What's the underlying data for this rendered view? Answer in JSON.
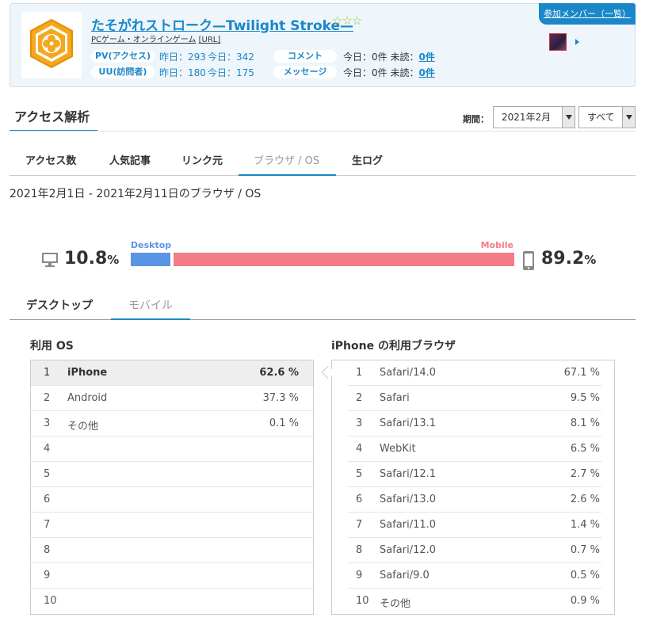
{
  "header": {
    "title": "たそがれストローク—Twilight Stroke—",
    "stars": "☆☆☆",
    "category": "PCゲーム・オンラインゲーム",
    "url_link": "[URL]",
    "member_button": "参加メンバー（一覧）",
    "pv_label": "PV(アクセス)",
    "uu_label": "UU(訪問者)",
    "pv_yesterday": "昨日：293",
    "pv_today": "今日：342",
    "uu_yesterday": "昨日：180",
    "uu_today": "今日：175",
    "comment_label": "コメント",
    "message_label": "メッセージ",
    "comment_today": "今日：0件",
    "comment_unread_label": "未読：",
    "comment_unread": "0件",
    "message_today": "今日：0件",
    "message_unread_label": "未読：",
    "message_unread": "0件"
  },
  "section": {
    "title": "アクセス解析",
    "period_label": "期間：",
    "period_value": "2021年2月",
    "filter_value": "すべて"
  },
  "tabs": [
    "アクセス数",
    "人気記事",
    "リンク元",
    "ブラウザ / OS",
    "生ログ"
  ],
  "date_range": "2021年2月1日 - 2021年2月11日のブラウザ / OS",
  "ratio": {
    "desktop_label": "Desktop",
    "mobile_label": "Mobile",
    "desktop_value": "10.8",
    "mobile_value": "89.2",
    "pct_sign": "%",
    "desktop_fraction": 0.108,
    "mobile_fraction": 0.892,
    "desktop_color": "#5b95e6",
    "mobile_color": "#f47c86"
  },
  "subtabs": [
    "デスクトップ",
    "モバイル"
  ],
  "os_table": {
    "title": "利用 OS",
    "rows": [
      {
        "rank": "1",
        "name": "iPhone",
        "value": "62.6 %"
      },
      {
        "rank": "2",
        "name": "Android",
        "value": "37.3 %"
      },
      {
        "rank": "3",
        "name": "その他",
        "value": "0.1 %"
      },
      {
        "rank": "4",
        "name": "",
        "value": ""
      },
      {
        "rank": "5",
        "name": "",
        "value": ""
      },
      {
        "rank": "6",
        "name": "",
        "value": ""
      },
      {
        "rank": "7",
        "name": "",
        "value": ""
      },
      {
        "rank": "8",
        "name": "",
        "value": ""
      },
      {
        "rank": "9",
        "name": "",
        "value": ""
      },
      {
        "rank": "10",
        "name": "",
        "value": ""
      }
    ]
  },
  "browser_table": {
    "title": "iPhone の利用ブラウザ",
    "rows": [
      {
        "rank": "1",
        "name": "Safari/14.0",
        "value": "67.1 %"
      },
      {
        "rank": "2",
        "name": "Safari",
        "value": "9.5 %"
      },
      {
        "rank": "3",
        "name": "Safari/13.1",
        "value": "8.1 %"
      },
      {
        "rank": "4",
        "name": "WebKit",
        "value": "6.5 %"
      },
      {
        "rank": "5",
        "name": "Safari/12.1",
        "value": "2.7 %"
      },
      {
        "rank": "6",
        "name": "Safari/13.0",
        "value": "2.6 %"
      },
      {
        "rank": "7",
        "name": "Safari/11.0",
        "value": "1.4 %"
      },
      {
        "rank": "8",
        "name": "Safari/12.0",
        "value": "0.7 %"
      },
      {
        "rank": "9",
        "name": "Safari/9.0",
        "value": "0.5 %"
      },
      {
        "rank": "10",
        "name": "その他",
        "value": "0.9 %"
      }
    ]
  }
}
